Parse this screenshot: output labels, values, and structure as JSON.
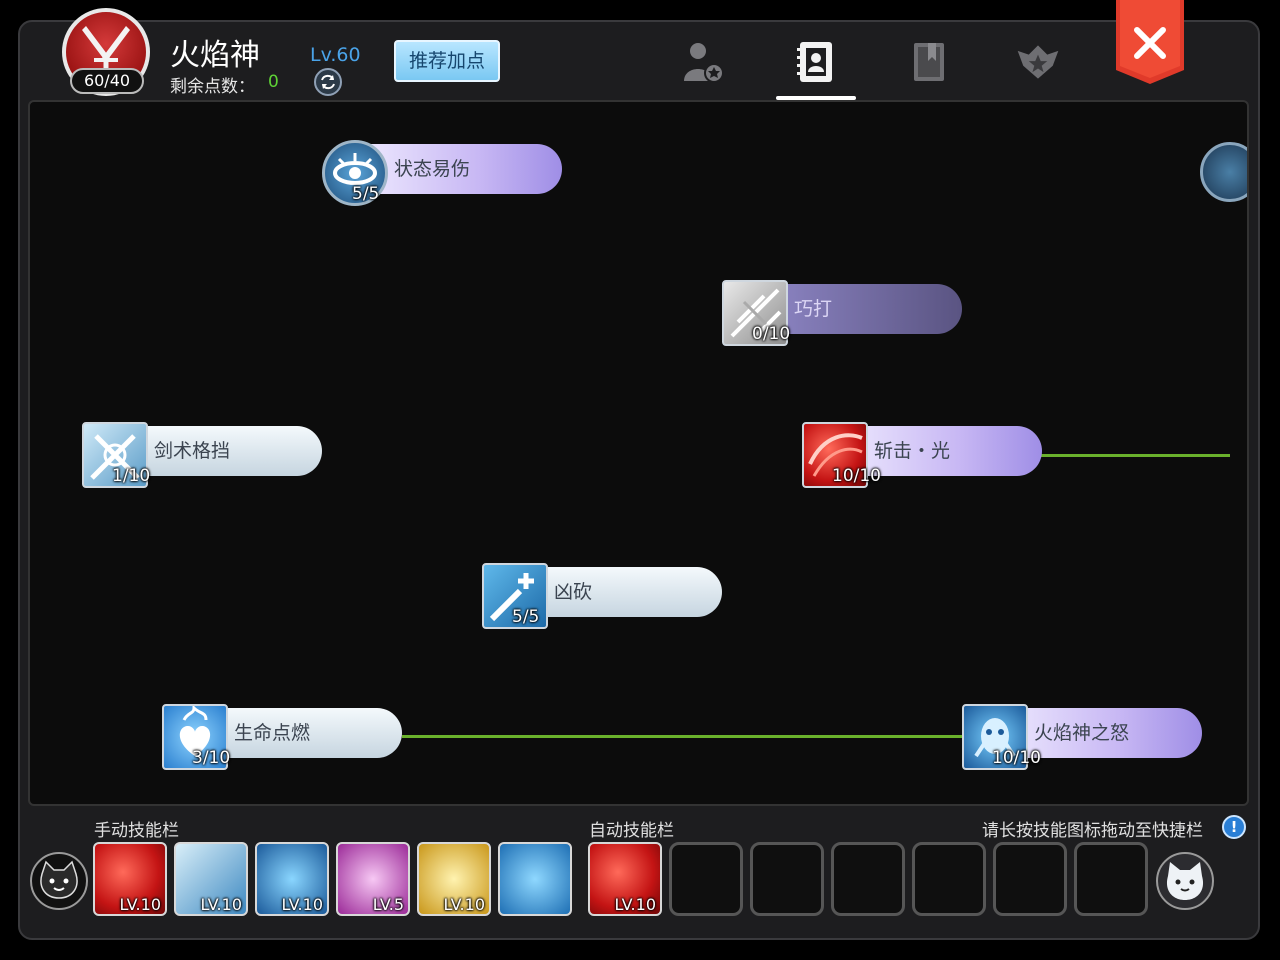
{
  "header": {
    "character_name": "火焰神",
    "level": "Lv.60",
    "skill_points_badge": "60/40",
    "remaining_points_label": "剩余点数：",
    "remaining_points_value": "0",
    "recommend_button": "推荐加点",
    "tabs": [
      {
        "icon": "profile-star-icon",
        "active": false
      },
      {
        "icon": "skill-book-icon",
        "active": true
      },
      {
        "icon": "bookmark-book-icon",
        "active": false
      },
      {
        "icon": "rank-emblem-icon",
        "active": false
      }
    ],
    "close_icon": "close-icon"
  },
  "skills": [
    {
      "name": "状态易伤",
      "count": "5/5",
      "icon": "eye-icon",
      "style": "purple"
    },
    {
      "name": "巧打",
      "count": "0/10",
      "icon": "strike-icon",
      "style": "dark"
    },
    {
      "name": "剑术格挡",
      "count": "1/10",
      "icon": "swords-block-icon",
      "style": "light"
    },
    {
      "name": "斩击・光",
      "count": "10/10",
      "icon": "slash-icon",
      "style": "purple"
    },
    {
      "name": "凶砍",
      "count": "5/5",
      "icon": "sword-plus-icon",
      "style": "light"
    },
    {
      "name": "生命点燃",
      "count": "3/10",
      "icon": "flame-heart-icon",
      "style": "light"
    },
    {
      "name": "火焰神之怒",
      "count": "10/10",
      "icon": "fire-spirit-icon",
      "style": "purple"
    }
  ],
  "hotbar": {
    "manual_label": "手动技能栏",
    "auto_label": "自动技能栏",
    "hint": "请长按技能图标拖动至快捷栏",
    "manual_slots": [
      {
        "level": "LV.10",
        "icon": "red-slash-icon"
      },
      {
        "level": "LV.10",
        "icon": "boot-dash-icon"
      },
      {
        "level": "LV.10",
        "icon": "blue-spirit-icon"
      },
      {
        "level": "LV.5",
        "icon": "pink-mask-icon"
      },
      {
        "level": "LV.10",
        "icon": "golden-crown-icon"
      },
      {
        "level": "",
        "icon": "sword-burst-icon"
      }
    ],
    "auto_slots": [
      {
        "level": "LV.10",
        "icon": "red-slash-icon"
      },
      {
        "level": "",
        "icon": ""
      },
      {
        "level": "",
        "icon": ""
      },
      {
        "level": "",
        "icon": ""
      },
      {
        "level": "",
        "icon": ""
      },
      {
        "level": "",
        "icon": ""
      },
      {
        "level": "",
        "icon": ""
      }
    ]
  },
  "colors": {
    "accent_blue": "#4aa3e8",
    "points_green": "#5ed236",
    "close_red": "#e03a2a",
    "link_line": "#6ab12c"
  }
}
